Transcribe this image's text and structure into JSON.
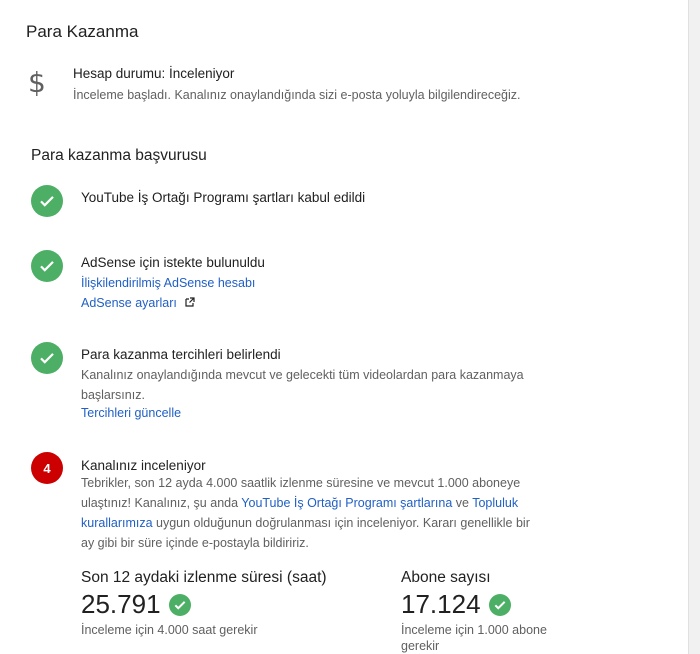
{
  "page_title": "Para Kazanma",
  "account": {
    "icon": "dollar-icon",
    "status": "Hesap durumu: İnceleniyor",
    "description": "İnceleme başladı. Kanalınız onaylandığında sizi e-posta yoluyla bilgilendireceğiz."
  },
  "section_title": "Para kazanma başvurusu",
  "steps": [
    {
      "icon": "check-icon",
      "title": "YouTube İş Ortağı Programı şartları kabul edildi"
    },
    {
      "icon": "check-icon",
      "title": "AdSense için istekte bulunuldu",
      "link1": "İlişkilendirilmiş AdSense hesabı",
      "link2": "AdSense ayarları"
    },
    {
      "icon": "check-icon",
      "title": "Para kazanma tercihleri belirlendi",
      "text_line1": "Kanalınız onaylandığında mevcut ve gelecekti tüm videolardan para kazanmaya",
      "text_line2": "başlarsınız.",
      "link": "Tercihleri güncelle"
    },
    {
      "number": "4",
      "title": "Kanalınız inceleniyor",
      "line1": "Tebrikler, son 12 ayda 4.000 saatlik izlenme süresine ve mevcut 1.000 aboneye",
      "line2_a": "ulaştınız! Kanalınız, şu anda ",
      "line2_link1": "YouTube İş Ortağı Programı şartlarına",
      "line2_b": " ve ",
      "line2_link2": "Topluluk",
      "line3_link": "kurallarımıza",
      "line3_b": " uygun olduğunun doğrulanması için inceleniyor. Kararı genellikle bir",
      "line4": "ay gibi bir süre içinde e-postayla bildiririz."
    }
  ],
  "stats": {
    "watch": {
      "label": "Son 12 aydaki izlenme süresi (saat)",
      "value": "25.791",
      "note": "İnceleme için 4.000 saat gerekir"
    },
    "subs": {
      "label": "Abone sayısı",
      "value": "17.124",
      "note_line1": "İnceleme için 1.000 abone",
      "note_line2": "gerekir"
    }
  },
  "colors": {
    "check_green": "#4caf65",
    "step_red": "#cc0000",
    "link_blue": "#2160c4"
  }
}
